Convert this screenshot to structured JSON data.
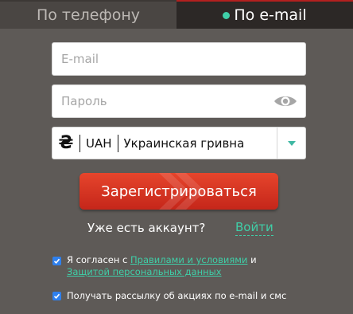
{
  "tabs": {
    "phone_label": "По телефону",
    "email_label": "По e-mail",
    "active": "email"
  },
  "form": {
    "email_placeholder": "E-mail",
    "password_placeholder": "Пароль",
    "currency": {
      "symbol": "₴",
      "code": "UAH",
      "name": "Украинская гривна"
    },
    "register_label": "Зарегистрироваться"
  },
  "account": {
    "question": "Уже есть аккаунт?",
    "login_label": "Войти"
  },
  "consent": {
    "prefix": "Я согласен с ",
    "rules_link": "Правилами и условиями",
    "and": " и ",
    "privacy_link": "Защитой персональных данных",
    "newsletter": "Получать рассылку об акциях по e-mail и смс",
    "checked": [
      true,
      true
    ]
  },
  "colors": {
    "accent": "#3fcfa8",
    "button": "#d8351f",
    "background": "#5e5a57",
    "checkbox": "#2f80ed"
  }
}
